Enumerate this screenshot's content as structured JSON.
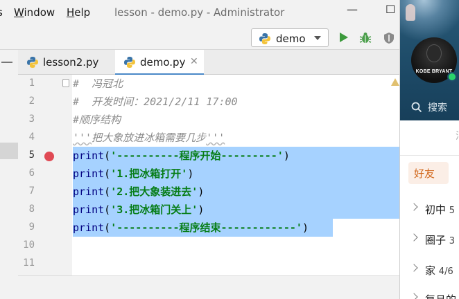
{
  "menubar": {
    "menu_s": "s",
    "menu_window": "Window",
    "menu_window_key": "W",
    "menu_window_rest": "indow",
    "menu_help_key": "H",
    "menu_help_rest": "elp",
    "title": "lesson - demo.py - Administrator",
    "minimize": "—",
    "maximize": "☐"
  },
  "toolbar": {
    "run_config": "demo",
    "icons": [
      "python-icon",
      "run-icon",
      "debug-icon",
      "coverage-icon"
    ]
  },
  "tabs": [
    {
      "label": "lesson2.py",
      "active": false
    },
    {
      "label": "demo.py",
      "active": true
    }
  ],
  "editor": {
    "line_numbers": [
      "1",
      "2",
      "3",
      "4",
      "5",
      "6",
      "7",
      "8",
      "9",
      "10",
      "11"
    ],
    "current_line": "5",
    "breakpoint_line": "5",
    "lines": {
      "l1": "#  冯冠北",
      "l2": "#  开发时间：2021/2/11 17:00",
      "l3": "#顺序结构",
      "l4_q1": "'''",
      "l4_text": "把大象放进冰箱需要几步",
      "l4_q2": "'''",
      "print_kw": "print",
      "l5_str": "'----------程序开始---------'",
      "l6_str": "'1.把冰箱打开'",
      "l7_str": "'2.把大象装进去'",
      "l8_str": "'3.把冰箱门关上'",
      "l9_str": "'----------程序结束------------'",
      "open_paren": "(",
      "close_paren": ")"
    },
    "colors": {
      "selection": "#a6d2ff",
      "keyword": "#000080",
      "string": "#067d17",
      "comment": "#8c8c8c",
      "breakpoint": "#e04a54"
    }
  },
  "qq": {
    "avatar_text": "KOBE BRYANT",
    "search_label": "搜索",
    "partial_char": "消",
    "tab_label": "好友",
    "groups": [
      {
        "name": "初中",
        "count": "5"
      },
      {
        "name": "圈子",
        "count": "3"
      },
      {
        "name": "家",
        "count": "4/6"
      },
      {
        "name": "复旦的",
        "count": ""
      }
    ],
    "online_color": "#2bd36b"
  }
}
